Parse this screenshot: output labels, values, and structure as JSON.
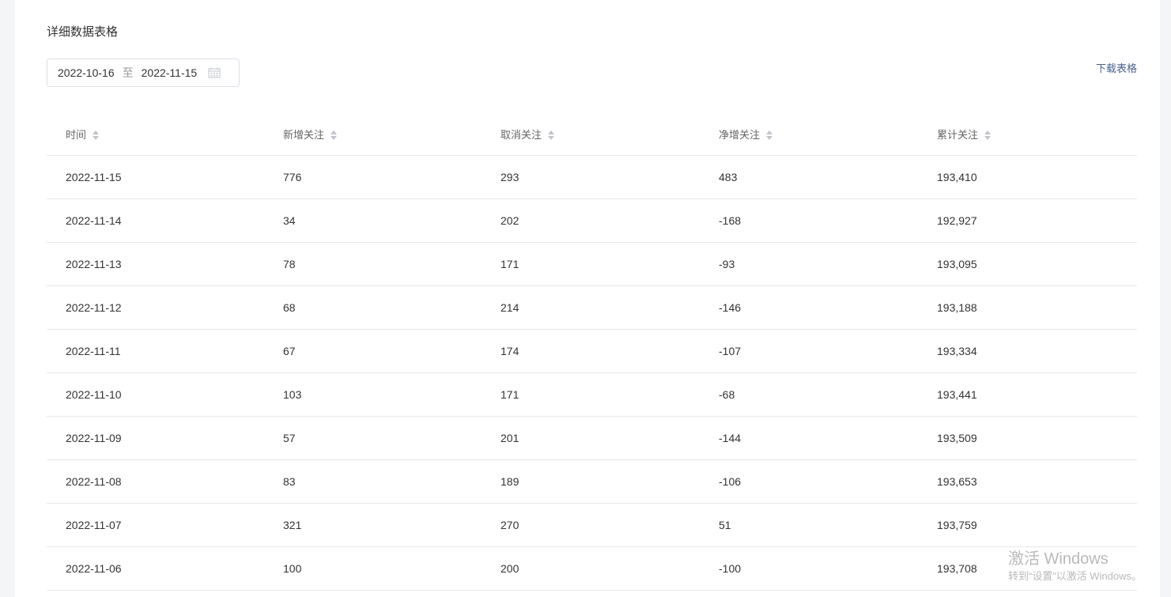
{
  "section": {
    "title": "详细数据表格"
  },
  "date_range": {
    "start": "2022-10-16",
    "separator": "至",
    "end": "2022-11-15",
    "icon": "calendar-icon"
  },
  "actions": {
    "download_label": "下载表格"
  },
  "table": {
    "columns": [
      "时间",
      "新增关注",
      "取消关注",
      "净增关注",
      "累计关注"
    ],
    "rows": [
      [
        "2022-11-15",
        "776",
        "293",
        "483",
        "193,410"
      ],
      [
        "2022-11-14",
        "34",
        "202",
        "-168",
        "192,927"
      ],
      [
        "2022-11-13",
        "78",
        "171",
        "-93",
        "193,095"
      ],
      [
        "2022-11-12",
        "68",
        "214",
        "-146",
        "193,188"
      ],
      [
        "2022-11-11",
        "67",
        "174",
        "-107",
        "193,334"
      ],
      [
        "2022-11-10",
        "103",
        "171",
        "-68",
        "193,441"
      ],
      [
        "2022-11-09",
        "57",
        "201",
        "-144",
        "193,509"
      ],
      [
        "2022-11-08",
        "83",
        "189",
        "-106",
        "193,653"
      ],
      [
        "2022-11-07",
        "321",
        "270",
        "51",
        "193,759"
      ],
      [
        "2022-11-06",
        "100",
        "200",
        "-100",
        "193,708"
      ]
    ]
  },
  "watermark": {
    "title": "激活 Windows",
    "subtitle": "转到“设置”以激活 Windows。"
  },
  "colors": {
    "link": "#4a5f8f",
    "border": "#e8e8e8",
    "sort_icon": "#c0c4cc"
  }
}
